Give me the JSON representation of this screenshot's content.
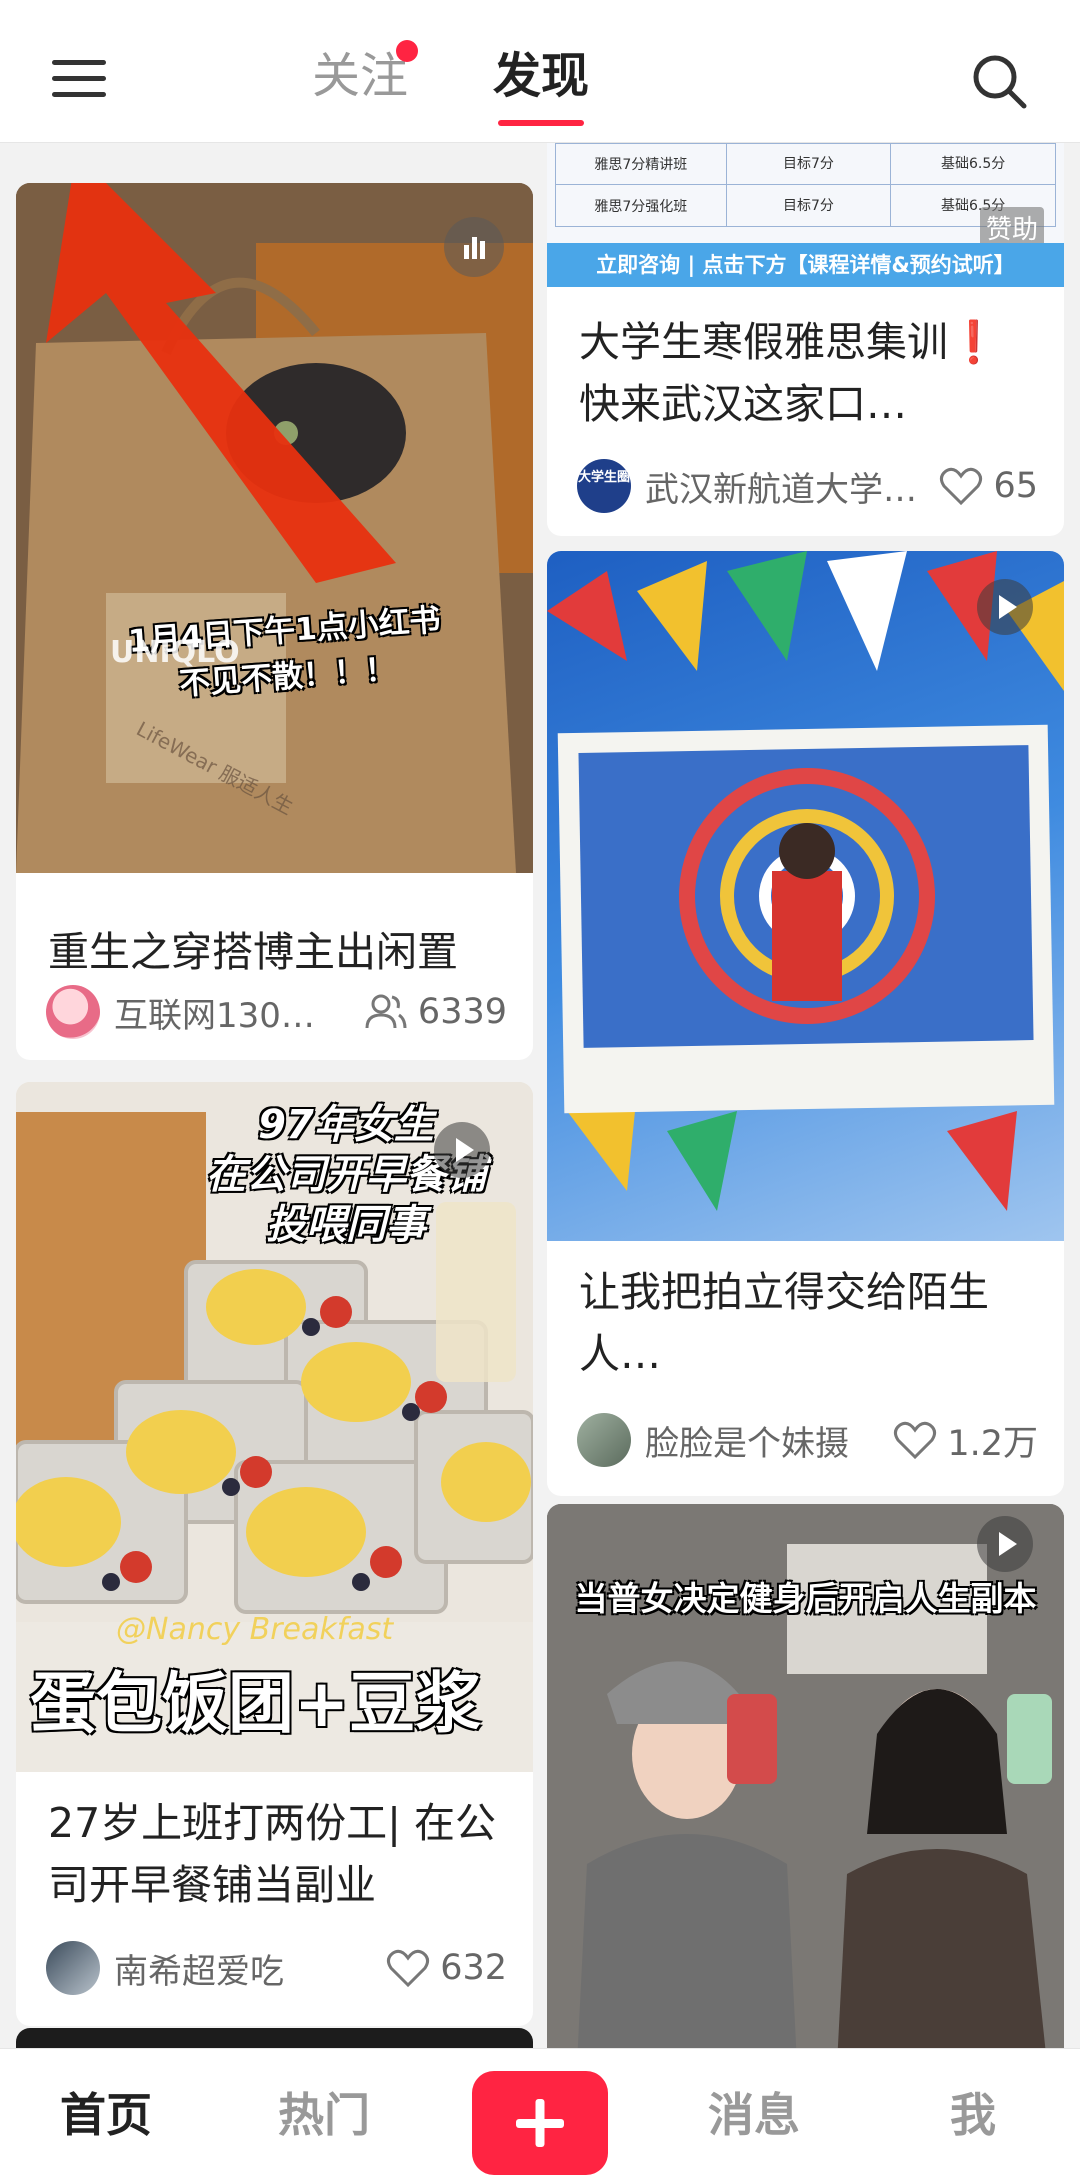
{
  "header": {
    "tabs": [
      {
        "label": "关注"
      },
      {
        "label": "发现"
      }
    ]
  },
  "feed": {
    "cards": [
      {
        "image_caption": "1月4日下午1点小红书不见不散！！！",
        "bag_brand_text": "UNIQLO",
        "bag_sub_text": "LifeWear 服适人生",
        "title": "重生之穿搭博主出闲置",
        "author": "互联网130…",
        "count": "6339",
        "count_icon": "people-icon"
      },
      {
        "ad_table": {
          "rows": [
            [
              "雅思7分精讲班",
              "目标7分",
              "基础6.5分"
            ],
            [
              "雅思7分强化班",
              "目标7分",
              "基础6.5分"
            ]
          ]
        },
        "ad_banner": "立即咨询 | 点击下方【课程详情&预约试听】",
        "sponsored_label": "赞助",
        "title": "大学生寒假雅思集训❗快来武汉这家口…",
        "author": "武汉新航道大学…",
        "author_avatar_text": "大学生圈",
        "count": "65",
        "count_icon": "heart-icon"
      },
      {
        "title": "让我把拍立得交给陌生人…",
        "author": "脸脸是个妹摄",
        "count": "1.2万",
        "count_icon": "heart-icon"
      },
      {
        "image_caption_lines": [
          "97年女生",
          "在公司开早餐铺",
          "投喂同事"
        ],
        "image_bottom_text": "蛋包饭团+豆浆",
        "watermark": "@Nancy Breakfast",
        "title": "27岁上班打两份工| 在公司开早餐铺当副业",
        "author": "南希超爱吃",
        "count": "632",
        "count_icon": "heart-icon"
      },
      {
        "image_caption": "当普女决定健身后开启人生副本"
      }
    ]
  },
  "bottom_nav": {
    "items": [
      {
        "label": "首页"
      },
      {
        "label": "热门"
      },
      {
        "label": "消息"
      },
      {
        "label": "我"
      }
    ],
    "add_icon": "plus-icon"
  },
  "colors": {
    "brand": "#ff2442",
    "annotation_arrow": "#e8300f"
  }
}
